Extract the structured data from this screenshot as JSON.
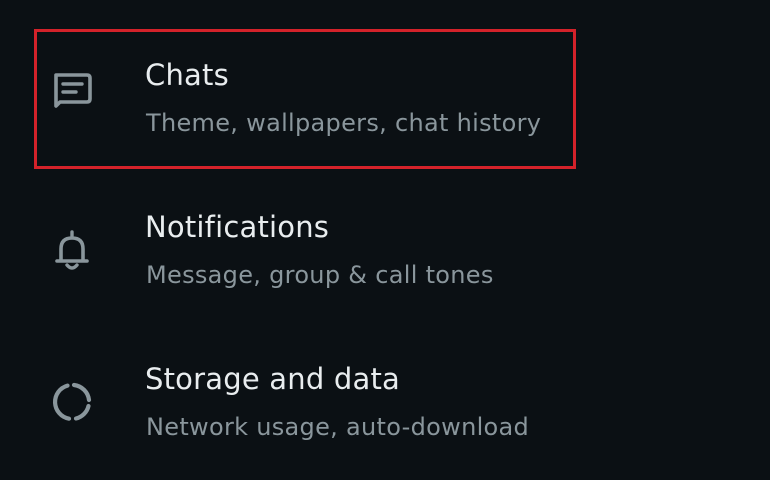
{
  "settings": {
    "items": [
      {
        "title": "Chats",
        "subtitle": "Theme, wallpapers, chat history",
        "icon": "chat-icon",
        "highlighted": true
      },
      {
        "title": "Notifications",
        "subtitle": "Message, group & call tones",
        "icon": "bell-icon",
        "highlighted": false
      },
      {
        "title": "Storage and data",
        "subtitle": "Network usage, auto-download",
        "icon": "storage-icon",
        "highlighted": false
      }
    ]
  },
  "colors": {
    "background": "#0b1014",
    "title_text": "#e9edef",
    "subtitle_text": "#8a969c",
    "icon": "#8a969c",
    "highlight_border": "#d3222a"
  }
}
